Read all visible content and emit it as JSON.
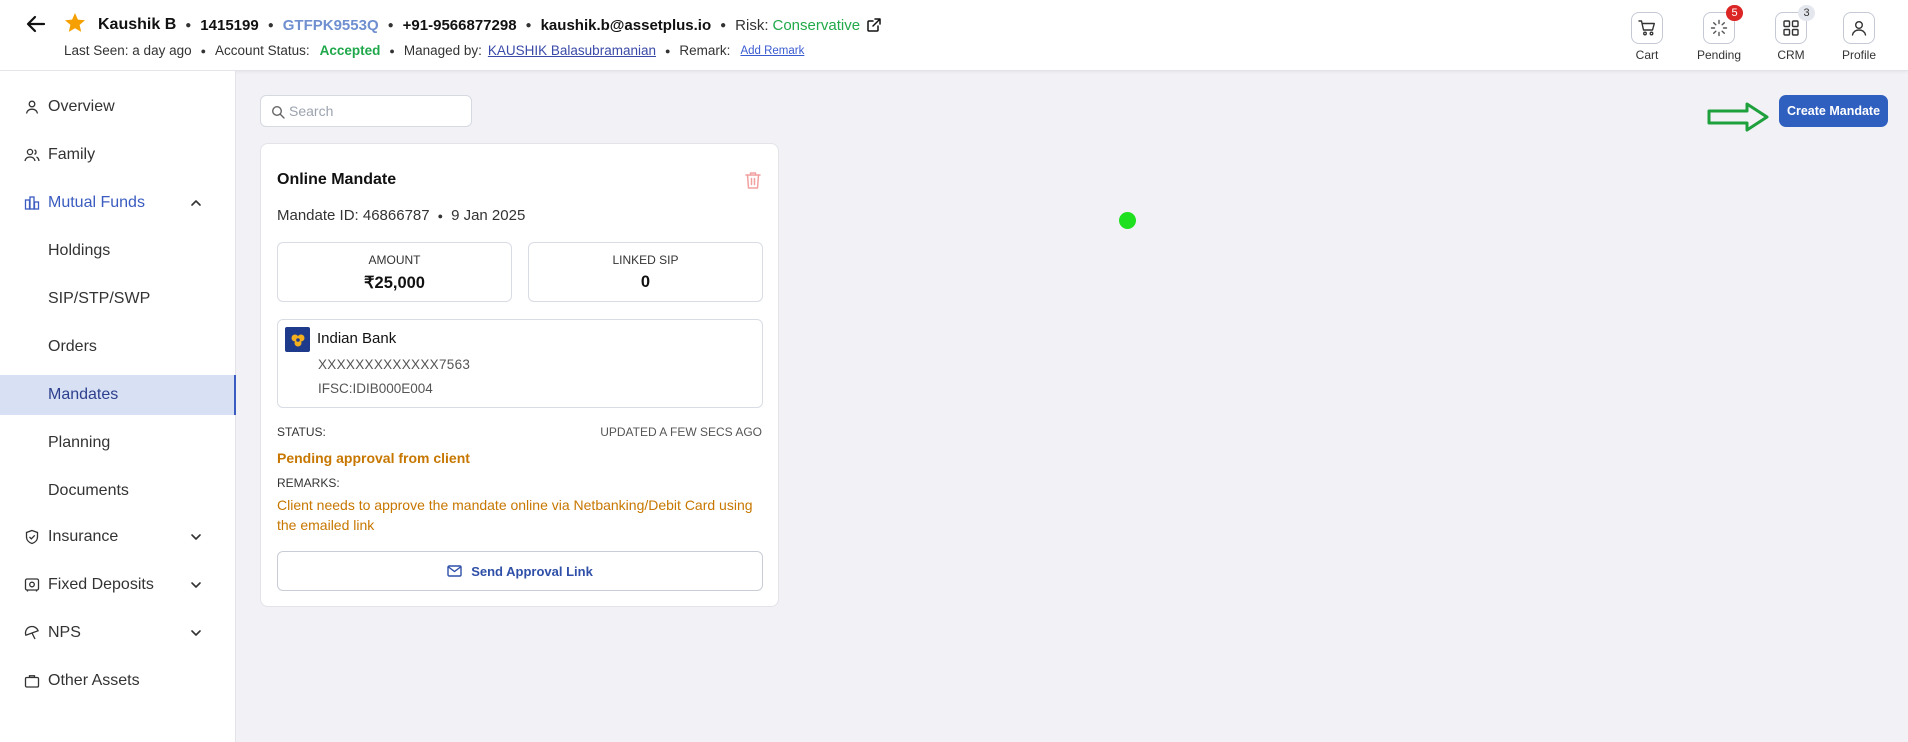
{
  "header": {
    "client_name": "Kaushik B",
    "client_id": "1415199",
    "pan": "GTFPK9553Q",
    "phone": "+91-9566877298",
    "email": "kaushik.b@assetplus.io",
    "risk_label": "Risk:",
    "risk_value": "Conservative",
    "last_seen": "Last Seen: a day ago",
    "account_status_label": "Account Status:",
    "account_status_value": "Accepted",
    "managed_by_label": "Managed by:",
    "managed_by_value": "KAUSHIK Balasubramanian",
    "remark_label": "Remark:",
    "add_remark": "Add Remark",
    "icons": {
      "cart": "Cart",
      "pending": "Pending",
      "pending_count": "5",
      "crm": "CRM",
      "crm_count": "3",
      "profile": "Profile"
    }
  },
  "sidebar": {
    "items": [
      {
        "label": "Overview",
        "icon": "user-icon"
      },
      {
        "label": "Family",
        "icon": "users-icon"
      },
      {
        "label": "Mutual Funds",
        "icon": "bank-building-icon"
      },
      {
        "label": "Holdings"
      },
      {
        "label": "SIP/STP/SWP"
      },
      {
        "label": "Orders"
      },
      {
        "label": "Mandates"
      },
      {
        "label": "Planning"
      },
      {
        "label": "Documents"
      },
      {
        "label": "Insurance",
        "icon": "shield-icon"
      },
      {
        "label": "Fixed Deposits",
        "icon": "safe-icon"
      },
      {
        "label": "NPS",
        "icon": "umbrella-icon"
      },
      {
        "label": "Other Assets",
        "icon": "briefcase-icon"
      }
    ]
  },
  "main": {
    "search_placeholder": "Search",
    "create_mandate": "Create Mandate",
    "card": {
      "title": "Online Mandate",
      "mandate_id": "Mandate ID: 46866787",
      "date": "9 Jan 2025",
      "amount_label": "AMOUNT",
      "amount_value": "₹25,000",
      "linked_sip_label": "LINKED SIP",
      "linked_sip_value": "0",
      "bank_name": "Indian Bank",
      "account_number": "XXXXXXXXXXXXX7563",
      "ifsc": "IFSC:IDIB000E004",
      "status_label": "STATUS:",
      "updated": "UPDATED A FEW SECS AGO",
      "status_value": "Pending approval from client",
      "remarks_label": "REMARKS:",
      "remarks_value": "Client needs to approve the mandate online via Netbanking/Debit Card using the emailed link",
      "send_link": "Send Approval Link"
    }
  },
  "colors": {
    "accent": "#2f5fbf",
    "pending_orange": "#c77700",
    "accepted_green": "#1fa84a",
    "badge_red": "#dc2626"
  }
}
